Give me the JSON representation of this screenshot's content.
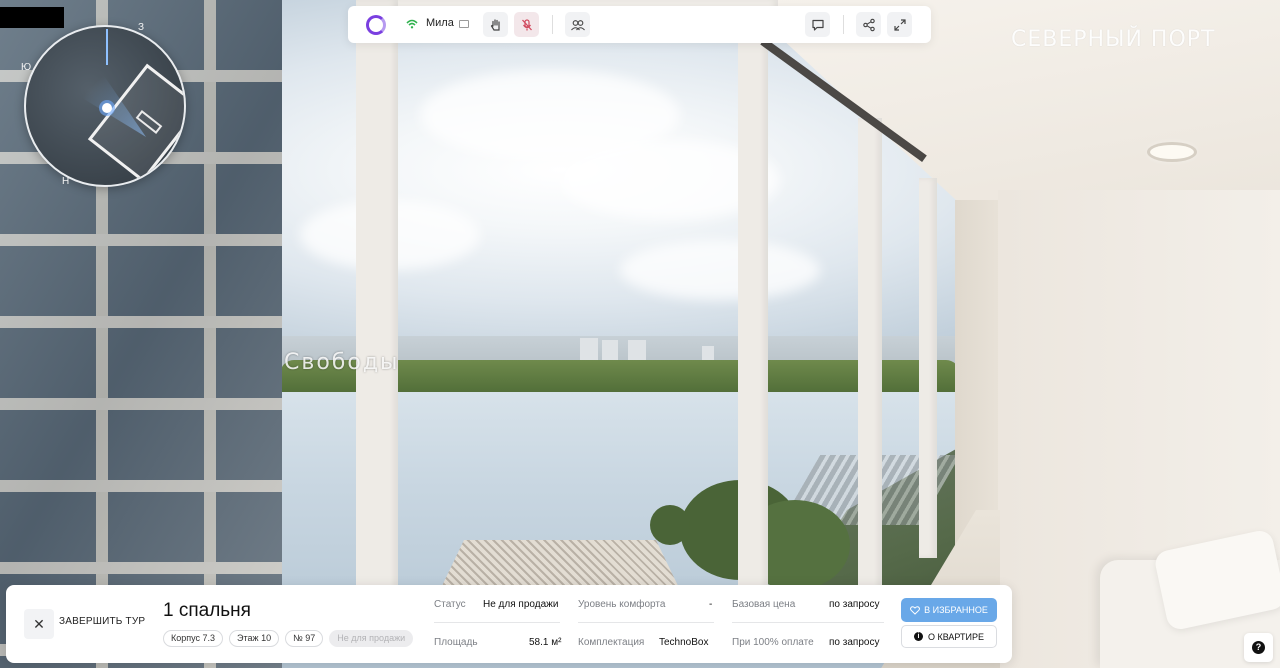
{
  "scene": {
    "street_label": "Свободы"
  },
  "minimap": {
    "compass_e": "З",
    "compass_s": "Ю",
    "compass_n": "Н"
  },
  "topbar": {
    "user_name": "Мила",
    "accent": "#7a3fe0",
    "icons": [
      "wifi-icon",
      "screen-icon",
      "hand-icon",
      "mic-off-icon",
      "users-icon",
      "chat-icon",
      "share-icon",
      "expand-icon"
    ]
  },
  "brand": {
    "name": "СЕВЕРНЫЙ ПОРТ"
  },
  "tour": {
    "end_label": "ЗАВЕРШИТЬ ТУР"
  },
  "apartment": {
    "title": "1 спальня",
    "chips": [
      "Корпус 7.3",
      "Этаж 10",
      "№ 97",
      "Не для продажи"
    ],
    "status_label": "Статус",
    "status_value": "Не для продажи",
    "area_label": "Площадь",
    "area_value": "58.1 м²",
    "comfort_label": "Уровень комфорта",
    "comfort_value": "-",
    "package_label": "Комплектация",
    "package_value": "TechnoBox",
    "base_price_label": "Базовая цена",
    "base_price_value": "по запросу",
    "full_pay_label": "При 100% оплате",
    "full_pay_value": "по запросу"
  },
  "actions": {
    "favorite_label": "В ИЗБРАННОЕ",
    "about_label": "О КВАРТИРЕ",
    "favorite_color": "#69a8e8"
  },
  "help": {
    "label": "?"
  }
}
